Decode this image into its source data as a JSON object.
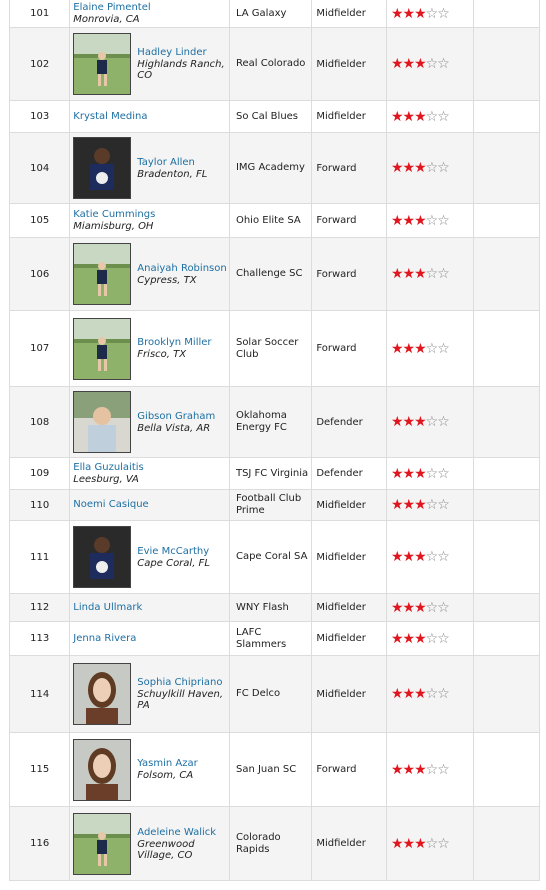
{
  "rows": [
    {
      "rank": "101",
      "name": "Elaine Pimentel",
      "location": "Monrovia, CA",
      "club": "LA Galaxy",
      "position": "Midfielder",
      "stars": 3,
      "photo": null
    },
    {
      "rank": "102",
      "name": "Hadley Linder",
      "location": "Highlands Ranch, CO",
      "club": "Real Colorado",
      "position": "Midfielder",
      "stars": 3,
      "photo": "field"
    },
    {
      "rank": "103",
      "name": "Krystal Medina",
      "location": "",
      "club": "So Cal Blues",
      "position": "Midfielder",
      "stars": 3,
      "photo": null
    },
    {
      "rank": "104",
      "name": "Taylor Allen",
      "location": "Bradenton, FL",
      "club": "IMG Academy",
      "position": "Forward",
      "stars": 3,
      "photo": "dark"
    },
    {
      "rank": "105",
      "name": "Katie Cummings",
      "location": "Miamisburg, OH",
      "club": "Ohio Elite SA",
      "position": "Forward",
      "stars": 3,
      "photo": null
    },
    {
      "rank": "106",
      "name": "Anaiyah Robinson",
      "location": "Cypress, TX",
      "club": "Challenge SC",
      "position": "Forward",
      "stars": 3,
      "photo": "field"
    },
    {
      "rank": "107",
      "name": "Brooklyn Miller",
      "location": "Frisco, TX",
      "club": "Solar Soccer Club",
      "position": "Forward",
      "stars": 3,
      "photo": "field"
    },
    {
      "rank": "108",
      "name": "Gibson Graham",
      "location": "Bella Vista, AR",
      "club": "Oklahoma Energy FC",
      "position": "Defender",
      "stars": 3,
      "photo": "light"
    },
    {
      "rank": "109",
      "name": "Ella Guzulaitis",
      "location": "Leesburg, VA",
      "club": "TSJ FC Virginia",
      "position": "Defender",
      "stars": 3,
      "photo": null
    },
    {
      "rank": "110",
      "name": "Noemi Casique",
      "location": "",
      "club": "Football Club Prime",
      "position": "Midfielder",
      "stars": 3,
      "photo": null
    },
    {
      "rank": "111",
      "name": "Evie McCarthy",
      "location": "Cape Coral, FL",
      "club": "Cape Coral SA",
      "position": "Midfielder",
      "stars": 3,
      "photo": "dark"
    },
    {
      "rank": "112",
      "name": "Linda Ullmark",
      "location": "",
      "club": "WNY Flash",
      "position": "Midfielder",
      "stars": 3,
      "photo": null
    },
    {
      "rank": "113",
      "name": "Jenna Rivera",
      "location": "",
      "club": "LAFC Slammers",
      "position": "Midfielder",
      "stars": 3,
      "photo": null
    },
    {
      "rank": "114",
      "name": "Sophia Chipriano",
      "location": "Schuylkill Haven, PA",
      "club": "FC Delco",
      "position": "Midfielder",
      "stars": 3,
      "photo": "portrait"
    },
    {
      "rank": "115",
      "name": "Yasmin Azar",
      "location": "Folsom, CA",
      "club": "San Juan SC",
      "position": "Forward",
      "stars": 3,
      "photo": "portrait"
    },
    {
      "rank": "116",
      "name": "Adeleine Walick",
      "location": "Greenwood Village, CO",
      "club": "Colorado Rapids",
      "position": "Midfielder",
      "stars": 3,
      "photo": "field"
    }
  ],
  "star_total": 5,
  "colors": {
    "star_on": "#e0151d",
    "star_off": "#888888",
    "link": "#1d6fa3",
    "row_alt": "#f4f4f4"
  },
  "icons": {
    "star_on": "red-star-icon",
    "star_off": "empty-star-icon",
    "photo": "player-photo"
  }
}
